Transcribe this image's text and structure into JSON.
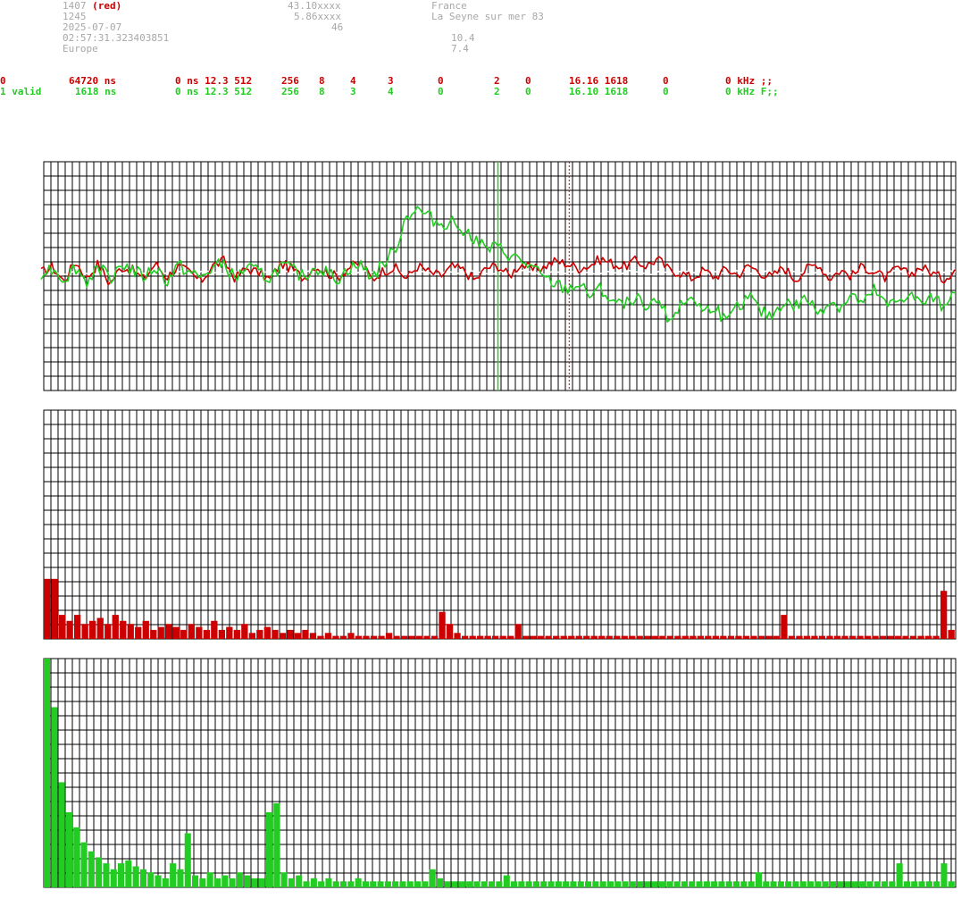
{
  "header": {
    "col1": [
      "1407",
      "1245",
      "2025-07-07",
      "02:57:31.323403851",
      "Europe"
    ],
    "col1_red_suffix": "(red)",
    "col2": [
      "43.10xxxx",
      "5.86xxxx",
      "46"
    ],
    "col3": [
      "France",
      "La Seyne sur mer 83"
    ],
    "col4": [
      "10.4",
      "7.4"
    ]
  },
  "rows": {
    "red": [
      "0",
      "64720 ns",
      "0 ns 12.3 512",
      "256",
      "8",
      "4",
      "3",
      "0",
      "2",
      "0",
      "16.16 1618",
      "0",
      "0 kHz ;;"
    ],
    "green": [
      "1 valid",
      "1618 ns",
      "0 ns 12.3 512",
      "256",
      "8",
      "3",
      "4",
      "0",
      "2",
      "0",
      "16.10 1618",
      "0",
      "0 kHz F;;"
    ]
  },
  "colors": {
    "red": "#cc0000",
    "green": "#22cc22",
    "grid": "#000000",
    "white_trace": "#ffffff",
    "label_gray": "#a8a8a8"
  },
  "chart_data": [
    {
      "type": "line",
      "grid": true,
      "xlim": [
        0,
        1024
      ],
      "ylim": [
        -1,
        1
      ],
      "markers": {
        "green_line_x": 510,
        "red_line_x": 590
      },
      "series": [
        {
          "color": "#cc0000",
          "values": [
            0.0,
            0.05,
            -0.08,
            0.1,
            -0.05,
            0.08,
            -0.1,
            0.05,
            0.02,
            -0.06,
            0.08,
            -0.04,
            0.05,
            0.0,
            -0.08,
            0.06,
            0.1,
            -0.05,
            0.04,
            0.0,
            -0.06,
            0.08,
            0.03,
            -0.05,
            0.06,
            0.0,
            -0.04,
            0.05,
            0.08,
            -0.06,
            0.02,
            0.04,
            -0.05,
            0.06,
            0.0,
            -0.03,
            0.05,
            0.02,
            -0.07,
            0.04,
            0.06,
            -0.03,
            0.08,
            0.02,
            0.05,
            0.1,
            0.08,
            0.04,
            0.06,
            0.12,
            0.08,
            0.05,
            0.1,
            0.06,
            0.12,
            0.02,
            0.0,
            -0.05,
            0.02,
            -0.04,
            0.03,
            -0.02,
            0.06,
            0.0,
            -0.04,
            0.05,
            -0.06,
            0.03,
            0.08,
            -0.05,
            0.02,
            -0.03,
            0.06,
            0.0,
            -0.05,
            0.04,
            -0.02,
            0.05,
            0.0,
            -0.06,
            0.03
          ]
        },
        {
          "color": "#22cc22",
          "values": [
            0.0,
            0.04,
            -0.06,
            0.05,
            -0.08,
            0.06,
            -0.05,
            0.08,
            0.02,
            -0.04,
            0.05,
            -0.08,
            0.06,
            0.0,
            -0.05,
            0.04,
            0.08,
            -0.06,
            0.05,
            0.0,
            -0.05,
            0.06,
            0.02,
            -0.04,
            0.05,
            0.0,
            -0.06,
            0.04,
            0.06,
            -0.04,
            0.08,
            0.2,
            0.5,
            0.55,
            0.48,
            0.42,
            0.45,
            0.38,
            0.3,
            0.2,
            0.22,
            0.15,
            0.1,
            0.04,
            -0.05,
            -0.1,
            -0.15,
            -0.1,
            -0.2,
            -0.15,
            -0.25,
            -0.3,
            -0.2,
            -0.35,
            -0.25,
            -0.4,
            -0.3,
            -0.2,
            -0.35,
            -0.28,
            -0.45,
            -0.3,
            -0.2,
            -0.35,
            -0.38,
            -0.25,
            -0.3,
            -0.22,
            -0.35,
            -0.25,
            -0.3,
            -0.2,
            -0.28,
            -0.15,
            -0.3,
            -0.25,
            -0.18,
            -0.28,
            -0.22,
            -0.3,
            -0.12
          ]
        }
      ]
    },
    {
      "type": "bar",
      "grid": true,
      "ylim": [
        0,
        16
      ],
      "color": "#cc0000",
      "values": [
        2,
        2,
        0.8,
        0.6,
        0.8,
        0.5,
        0.6,
        0.7,
        0.5,
        0.8,
        0.6,
        0.5,
        0.4,
        0.6,
        0.3,
        0.4,
        0.5,
        0.4,
        0.3,
        0.5,
        0.4,
        0.3,
        0.6,
        0.3,
        0.4,
        0.3,
        0.5,
        0.2,
        0.3,
        0.4,
        0.3,
        0.2,
        0.3,
        0.2,
        0.3,
        0.2,
        0.1,
        0.2,
        0.1,
        0.1,
        0.2,
        0.1,
        0.1,
        0.1,
        0.1,
        0.2,
        0.1,
        0.1,
        0.1,
        0.1,
        0.1,
        0.1,
        0.9,
        0.5,
        0.2,
        0.1,
        0.1,
        0.1,
        0.1,
        0.1,
        0.1,
        0.1,
        0.5,
        0.1,
        0.1,
        0.1,
        0.1,
        0.1,
        0.1,
        0.1,
        0.1,
        0.1,
        0.1,
        0.1,
        0.1,
        0.1,
        0.1,
        0.1,
        0.1,
        0.1,
        0.1,
        0.1,
        0.1,
        0.1,
        0.1,
        0.1,
        0.1,
        0.1,
        0.1,
        0.1,
        0.1,
        0.1,
        0.1,
        0.1,
        0.1,
        0.1,
        0.1,
        0.8,
        0.1,
        0.1,
        0.1,
        0.1,
        0.1,
        0.1,
        0.1,
        0.1,
        0.1,
        0.1,
        0.1,
        0.1,
        0.1,
        0.1,
        0.1,
        0.1,
        0.1,
        0.1,
        0.1,
        0.1,
        1.6,
        0.3
      ]
    },
    {
      "type": "bar",
      "grid": true,
      "ylim": [
        0,
        16
      ],
      "color": "#22cc22",
      "values": [
        8,
        6,
        3.5,
        2.5,
        2,
        1.5,
        1.2,
        1,
        0.8,
        0.6,
        0.8,
        0.9,
        0.7,
        0.6,
        0.5,
        0.4,
        0.3,
        0.8,
        0.6,
        1.8,
        0.4,
        0.3,
        0.5,
        0.3,
        0.4,
        0.3,
        0.5,
        0.4,
        0.3,
        0.3,
        2.5,
        2.8,
        0.5,
        0.3,
        0.4,
        0.2,
        0.3,
        0.2,
        0.3,
        0.2,
        0.2,
        0.2,
        0.3,
        0.2,
        0.2,
        0.2,
        0.2,
        0.2,
        0.2,
        0.2,
        0.2,
        0.2,
        0.6,
        0.3,
        0.2,
        0.2,
        0.2,
        0.2,
        0.2,
        0.2,
        0.2,
        0.2,
        0.4,
        0.2,
        0.2,
        0.2,
        0.2,
        0.2,
        0.2,
        0.2,
        0.2,
        0.2,
        0.2,
        0.2,
        0.2,
        0.2,
        0.2,
        0.2,
        0.2,
        0.2,
        0.2,
        0.2,
        0.2,
        0.2,
        0.2,
        0.2,
        0.2,
        0.2,
        0.2,
        0.2,
        0.2,
        0.2,
        0.2,
        0.2,
        0.2,
        0.2,
        0.5,
        0.2,
        0.2,
        0.2,
        0.2,
        0.2,
        0.2,
        0.2,
        0.2,
        0.2,
        0.2,
        0.2,
        0.2,
        0.2,
        0.2,
        0.2,
        0.2,
        0.2,
        0.2,
        0.8,
        0.2,
        0.2,
        0.2,
        0.2,
        0.2,
        0.8,
        0.2
      ]
    }
  ]
}
